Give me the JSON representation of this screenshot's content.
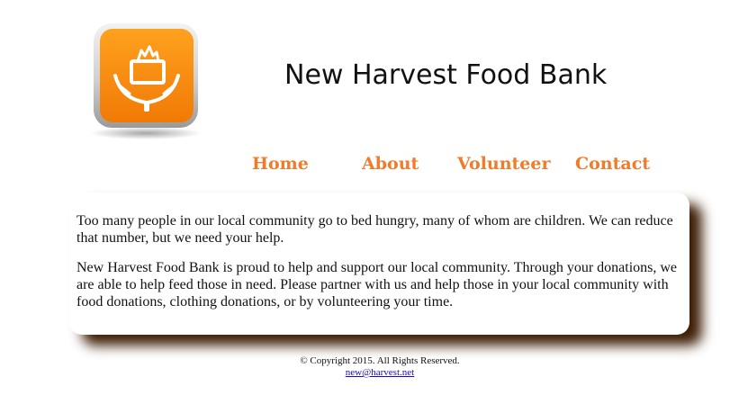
{
  "header": {
    "logo_icon": "hands-holding-food-box-icon",
    "title": "New Harvest Food Bank"
  },
  "nav": {
    "items": [
      {
        "label": "Home"
      },
      {
        "label": "About"
      },
      {
        "label": "Volunteer"
      },
      {
        "label": "Contact"
      }
    ]
  },
  "main": {
    "paragraphs": [
      "Too many people in our local community go to bed hungry, many of whom are children. We can reduce that number, but we need your help.",
      "New Harvest Food Bank is proud to help and support our local community. Through your donations, we are able to help feed those in need. Please partner with us and help those in your local community with food donations, clothing donations, or by volunteering your time."
    ]
  },
  "footer": {
    "copyright": "© Copyright 2015. All Rights Reserved.",
    "email": "new@harvest.net"
  },
  "colors": {
    "nav_link": "#ef7b2b",
    "logo_orange": "#f58a12",
    "box_shadow": "#3e1e05"
  }
}
